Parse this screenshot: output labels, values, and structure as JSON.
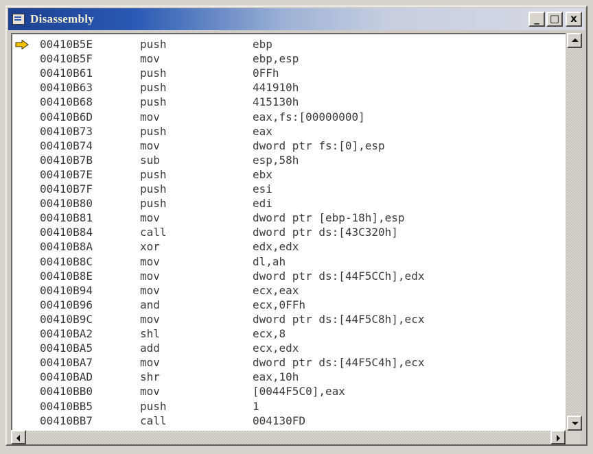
{
  "window": {
    "title": "Disassembly",
    "buttons": {
      "minimize": "_",
      "maximize": "□",
      "close": "x"
    }
  },
  "current_row_marker": "arrow-icon",
  "rows": [
    {
      "address": "00410B5E",
      "mnemonic": "push",
      "operands": "ebp"
    },
    {
      "address": "00410B5F",
      "mnemonic": "mov",
      "operands": "ebp,esp"
    },
    {
      "address": "00410B61",
      "mnemonic": "push",
      "operands": "0FFh"
    },
    {
      "address": "00410B63",
      "mnemonic": "push",
      "operands": "441910h"
    },
    {
      "address": "00410B68",
      "mnemonic": "push",
      "operands": "415130h"
    },
    {
      "address": "00410B6D",
      "mnemonic": "mov",
      "operands": "eax,fs:[00000000]"
    },
    {
      "address": "00410B73",
      "mnemonic": "push",
      "operands": "eax"
    },
    {
      "address": "00410B74",
      "mnemonic": "mov",
      "operands": "dword ptr fs:[0],esp"
    },
    {
      "address": "00410B7B",
      "mnemonic": "sub",
      "operands": "esp,58h"
    },
    {
      "address": "00410B7E",
      "mnemonic": "push",
      "operands": "ebx"
    },
    {
      "address": "00410B7F",
      "mnemonic": "push",
      "operands": "esi"
    },
    {
      "address": "00410B80",
      "mnemonic": "push",
      "operands": "edi"
    },
    {
      "address": "00410B81",
      "mnemonic": "mov",
      "operands": "dword ptr [ebp-18h],esp"
    },
    {
      "address": "00410B84",
      "mnemonic": "call",
      "operands": "dword ptr ds:[43C320h]"
    },
    {
      "address": "00410B8A",
      "mnemonic": "xor",
      "operands": "edx,edx"
    },
    {
      "address": "00410B8C",
      "mnemonic": "mov",
      "operands": "dl,ah"
    },
    {
      "address": "00410B8E",
      "mnemonic": "mov",
      "operands": "dword ptr ds:[44F5CCh],edx"
    },
    {
      "address": "00410B94",
      "mnemonic": "mov",
      "operands": "ecx,eax"
    },
    {
      "address": "00410B96",
      "mnemonic": "and",
      "operands": "ecx,0FFh"
    },
    {
      "address": "00410B9C",
      "mnemonic": "mov",
      "operands": "dword ptr ds:[44F5C8h],ecx"
    },
    {
      "address": "00410BA2",
      "mnemonic": "shl",
      "operands": "ecx,8"
    },
    {
      "address": "00410BA5",
      "mnemonic": "add",
      "operands": "ecx,edx"
    },
    {
      "address": "00410BA7",
      "mnemonic": "mov",
      "operands": "dword ptr ds:[44F5C4h],ecx"
    },
    {
      "address": "00410BAD",
      "mnemonic": "shr",
      "operands": "eax,10h"
    },
    {
      "address": "00410BB0",
      "mnemonic": "mov",
      "operands": "[0044F5C0],eax"
    },
    {
      "address": "00410BB5",
      "mnemonic": "push",
      "operands": "1"
    },
    {
      "address": "00410BB7",
      "mnemonic": "call",
      "operands": "004130FD"
    }
  ],
  "colors": {
    "title_gradient_start": "#1d3f8f",
    "title_text": "#f4eecb",
    "code_text": "#3a3a3a",
    "arrow_fill": "#f2c200"
  }
}
